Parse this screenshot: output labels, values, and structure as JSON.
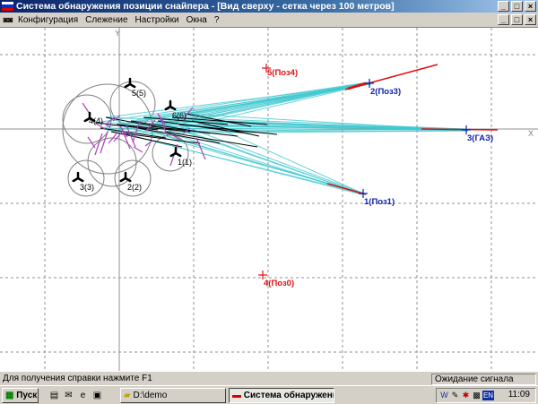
{
  "window": {
    "title": "Система обнаружения позиции снайпера - [Вид сверху - сетка через 100 метров]"
  },
  "menu": {
    "items": [
      "Конфигурация",
      "Слежение",
      "Настройки",
      "Окна",
      "?"
    ]
  },
  "plot": {
    "axis_y_label": "Y",
    "axis_x_label": "X",
    "sensors": [
      {
        "label": "1(1)"
      },
      {
        "label": "2(2)"
      },
      {
        "label": "3(3)"
      },
      {
        "label": "4(4)"
      },
      {
        "label": "5(5)"
      },
      {
        "label": "6(6)"
      }
    ],
    "targets": [
      {
        "label": "5(Поз4)",
        "color": "#e01010"
      },
      {
        "label": "2(Поз3)",
        "color": "#1020b0"
      },
      {
        "label": "3(ГАЗ)",
        "color": "#1020b0"
      },
      {
        "label": "1(Поз1)",
        "color": "#1020b0"
      },
      {
        "label": "4(Поз0)",
        "color": "#e01010"
      }
    ],
    "colors": {
      "grid": "#909090",
      "beam": "#40c8d0",
      "fan": "#b040c0",
      "mark_red": "#e01010",
      "mark_blue": "#1020b0"
    }
  },
  "status": {
    "help": "Для получения справки нажмите F1",
    "state": "Ожидание сигнала"
  },
  "taskbar": {
    "start": "Пуск",
    "tasks": [
      "D:\\demo",
      "Система обнаружени..."
    ],
    "clock": "11:09",
    "lang": "EN"
  }
}
